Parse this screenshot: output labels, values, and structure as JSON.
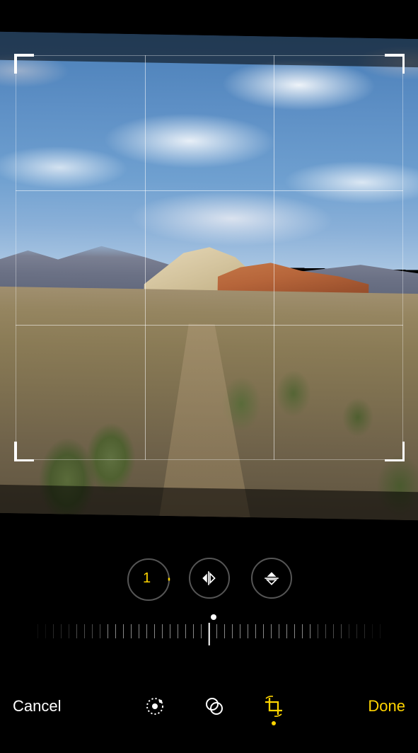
{
  "buttons": {
    "cancel": "Cancel",
    "done": "Done"
  },
  "straighten": {
    "value": "1",
    "active": true
  },
  "tools": {
    "flip_horizontal": "flip-horizontal-icon",
    "flip_vertical": "flip-vertical-icon"
  },
  "bottom_tabs": {
    "adjust": "adjust-icon",
    "filters": "filters-icon",
    "crop": "crop-rotate-icon",
    "active": "crop"
  },
  "colors": {
    "accent": "#ffd400",
    "background": "#000000"
  }
}
